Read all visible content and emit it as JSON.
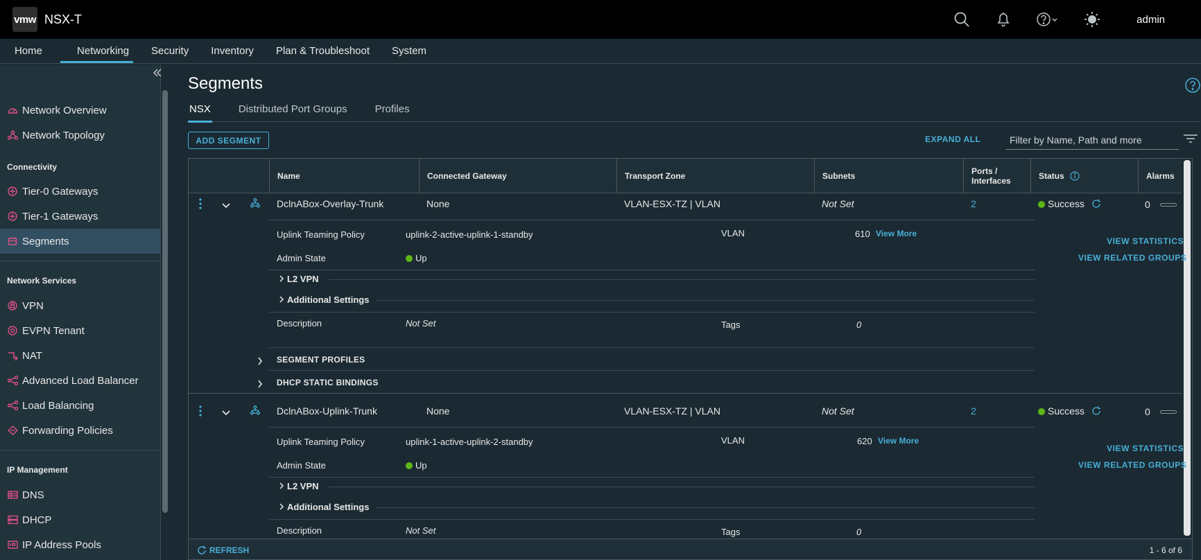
{
  "header": {
    "logo_text": "vmw",
    "app_title": "NSX-T",
    "user": "admin"
  },
  "topnav": [
    "Home",
    "Networking",
    "Security",
    "Inventory",
    "Plan & Troubleshoot",
    "System"
  ],
  "sidebar": {
    "items_top": [
      "Network Overview",
      "Network Topology"
    ],
    "groups": [
      "Connectivity",
      "Network Services",
      "IP Management"
    ],
    "connectivity": [
      "Tier-0 Gateways",
      "Tier-1 Gateways",
      "Segments"
    ],
    "network_services": [
      "VPN",
      "EVPN Tenant",
      "NAT",
      "Advanced Load Balancer",
      "Load Balancing",
      "Forwarding Policies"
    ],
    "ip_management": [
      "DNS",
      "DHCP",
      "IP Address Pools"
    ]
  },
  "page": {
    "title": "Segments",
    "tabs": [
      "NSX",
      "Distributed Port Groups",
      "Profiles"
    ],
    "add_button": "ADD SEGMENT",
    "expand_all": "EXPAND ALL",
    "filter_placeholder": "Filter by Name, Path and more"
  },
  "grid": {
    "columns": [
      "Name",
      "Connected Gateway",
      "Transport Zone",
      "Subnets",
      "Ports /",
      "Interfaces",
      "Status",
      "Alarms"
    ],
    "rows": [
      {
        "name": "DclnABox-Overlay-Trunk",
        "gateway": "None",
        "transport_zone": "VLAN-ESX-TZ | VLAN",
        "subnets": "Not Set",
        "ports": "2",
        "status": "Success",
        "alarms": "0",
        "uplink_label": "Uplink Teaming Policy",
        "uplink_value": "uplink-2-active-uplink-1-standby",
        "vlan_label": "VLAN",
        "vlan_value": "610",
        "view_more": "View More",
        "admin_label": "Admin State",
        "admin_value": "Up",
        "l2vpn": "L2 VPN",
        "additional": "Additional Settings",
        "desc_label": "Description",
        "desc_value": "Not Set",
        "tags_label": "Tags",
        "tags_value": "0",
        "segment_profiles": "SEGMENT PROFILES",
        "dhcp_bindings": "DHCP STATIC BINDINGS",
        "view_statistics": "VIEW STATISTICS",
        "view_related": "VIEW RELATED GROUPS"
      },
      {
        "name": "DclnABox-Uplink-Trunk",
        "gateway": "None",
        "transport_zone": "VLAN-ESX-TZ | VLAN",
        "subnets": "Not Set",
        "ports": "2",
        "status": "Success",
        "alarms": "0",
        "uplink_label": "Uplink Teaming Policy",
        "uplink_value": "uplink-1-active-uplink-2-standby",
        "vlan_label": "VLAN",
        "vlan_value": "620",
        "view_more": "View More",
        "admin_label": "Admin State",
        "admin_value": "Up",
        "l2vpn": "L2 VPN",
        "additional": "Additional Settings",
        "desc_label": "Description",
        "desc_value": "Not Set",
        "tags_label": "Tags",
        "tags_value": "0",
        "view_statistics": "VIEW STATISTICS",
        "view_related": "VIEW RELATED GROUPS"
      }
    ],
    "refresh": "REFRESH",
    "pagecount": "1 - 6 of 6"
  },
  "colors": {
    "accent": "#49afd9",
    "success": "#5eb715",
    "icon_pink": "#e05086"
  }
}
